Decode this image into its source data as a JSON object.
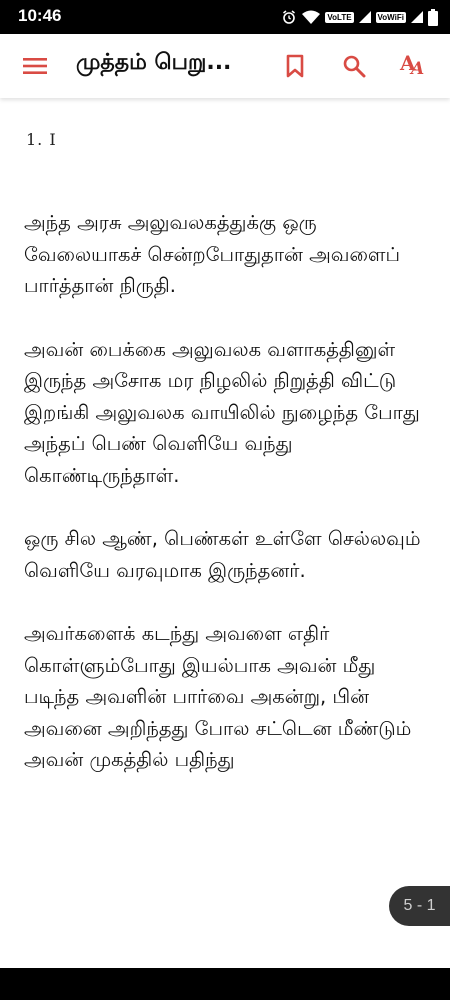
{
  "status_bar": {
    "time": "10:46",
    "network_1": "VoLTE",
    "network_2": "VoWiFi"
  },
  "app_bar": {
    "title": "முத்தம் பெறு...",
    "menu_icon": "hamburger-menu-icon",
    "bookmark_icon": "bookmark-icon",
    "search_icon": "search-icon",
    "font_icon": "font-size-icon",
    "accent_color": "#d94b44"
  },
  "content": {
    "chapter_label": "1. I",
    "paragraphs": [
      "அந்த அரசு அலுவலகத்துக்கு ஒரு வேலையாகச் சென்றபோதுதான் அவளைப் பார்த்தான் நிருதி.",
      "அவன் பைக்கை அலுவலக வளாகத்தினுள் இருந்த அசோக மர நிழலில் நிறுத்தி விட்டு இறங்கி அலுவலக வாயிலில் நுழைந்த போது அந்தப் பெண் வெளியே வந்து கொண்டிருந்தாள்.",
      "ஒரு சில ஆண், பெண்கள் உள்ளே செல்லவும் வெளியே வரவுமாக இருந்தனர்.",
      "அவர்களைக் கடந்து அவளை எதிர் கொள்ளும்போது இயல்பாக அவன் மீது படிந்த அவளின் பார்வை அகன்று, பின் அவனை அறிந்தது போல சட்டென மீண்டும் அவன் முகத்தில் பதிந்து"
    ]
  },
  "page_indicator": "5 - 1"
}
